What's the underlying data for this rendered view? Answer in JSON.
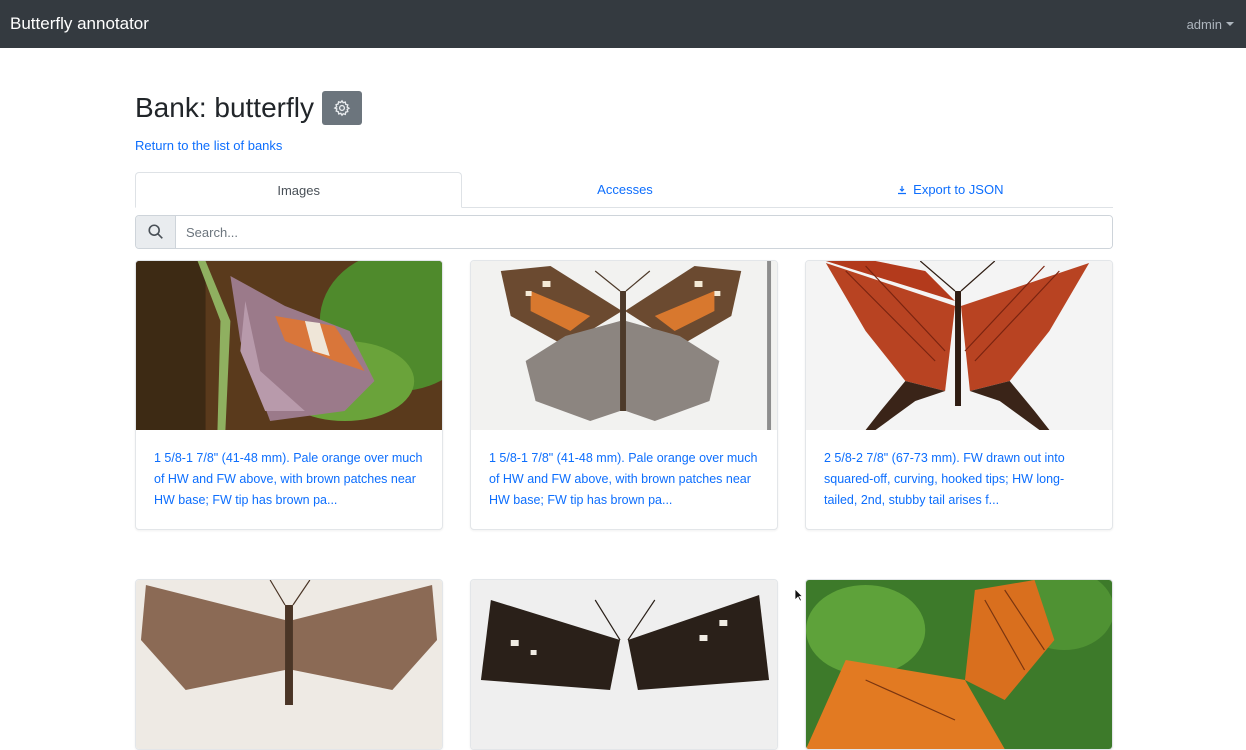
{
  "navbar": {
    "brand": "Butterfly annotator",
    "user": "admin"
  },
  "page": {
    "title": "Bank: butterfly",
    "return_link": "Return to the list of banks",
    "settings_icon": "gear-icon"
  },
  "tabs": [
    {
      "label": "Images",
      "active": true
    },
    {
      "label": "Accesses",
      "active": false
    },
    {
      "label": "Export to JSON",
      "active": false,
      "icon": "download-icon"
    }
  ],
  "search": {
    "placeholder": "Search...",
    "value": "",
    "icon": "search-icon"
  },
  "cards": [
    {
      "description": "1 5/8-1 7/8\" (41-48 mm). Pale orange over much of HW and FW above, with brown patches near HW base; FW tip has brown pa..."
    },
    {
      "description": "1 5/8-1 7/8\" (41-48 mm). Pale orange over much of HW and FW above, with brown patches near HW base; FW tip has brown pa..."
    },
    {
      "description": "2 5/8-2 7/8\" (67-73 mm). FW drawn out into squared-off, curving, hooked tips; HW long-tailed, 2nd, stubby tail arises f..."
    },
    {
      "description": ""
    },
    {
      "description": ""
    },
    {
      "description": ""
    }
  ],
  "colors": {
    "navbar": "#343a40",
    "link": "#0d6efd",
    "settings_button": "#6c757d"
  }
}
